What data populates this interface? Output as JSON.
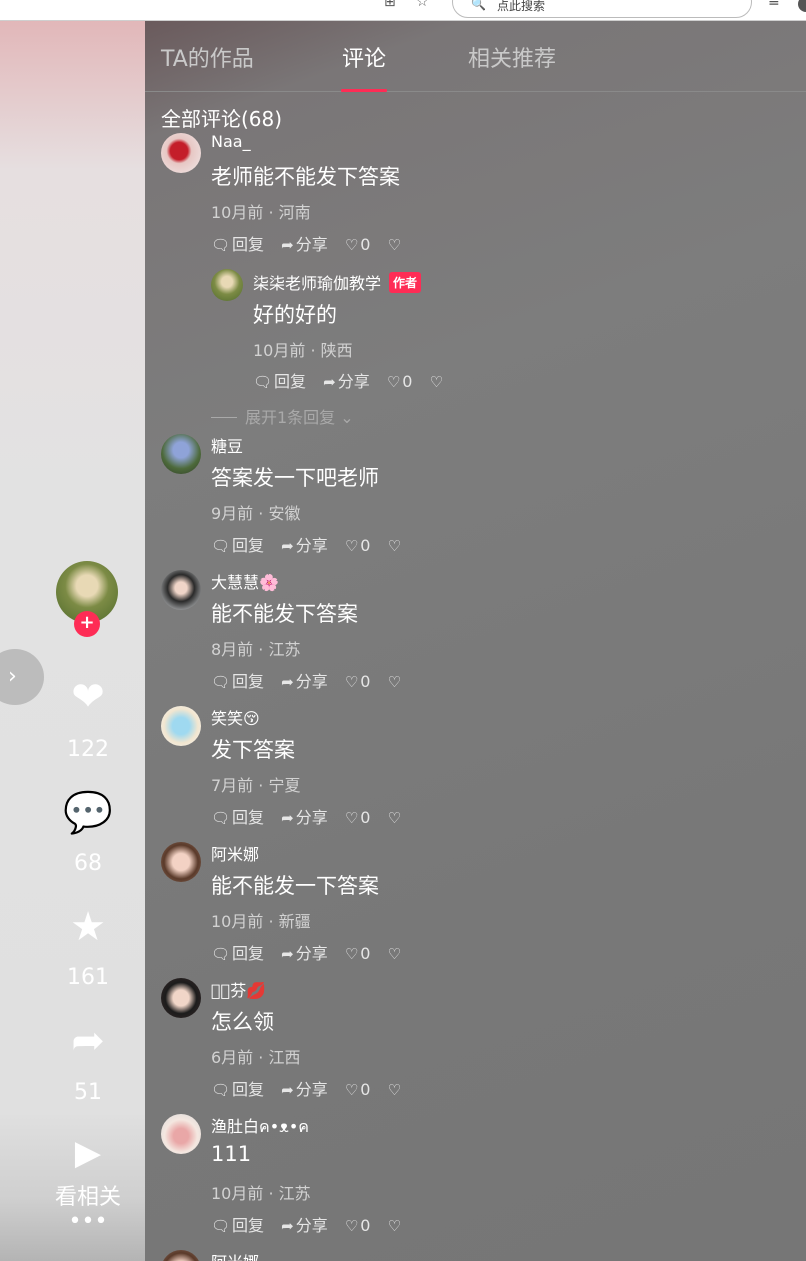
{
  "browser": {
    "search_placeholder": "点此搜索"
  },
  "sidebar": {
    "like_count": "122",
    "comment_count": "68",
    "favorite_count": "161",
    "share_count": "51",
    "related_label": "看相关",
    "more_label": "•••"
  },
  "tabs": [
    {
      "label": "TA的作品",
      "active": false
    },
    {
      "label": "评论",
      "active": true
    },
    {
      "label": "相关推荐",
      "active": false
    }
  ],
  "comments_header": "全部评论(68)",
  "actions": {
    "reply": "回复",
    "share": "分享"
  },
  "author_badge": "作者",
  "expand_label": "展开1条回复",
  "comments": [
    {
      "user": "Naa_",
      "text": "老师能不能发下答案",
      "meta": "10月前 · 河南",
      "likes": "0"
    },
    {
      "user": "糖豆",
      "text": "答案发一下吧老师",
      "meta": "9月前 · 安徽",
      "likes": "0"
    },
    {
      "user": "大慧慧🌸",
      "text": "能不能发下答案",
      "meta": "8月前 · 江苏",
      "likes": "0"
    },
    {
      "user": "笑笑😚",
      "text": "发下答案",
      "meta": "7月前 · 宁夏",
      "likes": "0"
    },
    {
      "user": "阿米娜",
      "text": "能不能发一下答案",
      "meta": "10月前 · 新疆",
      "likes": "0"
    },
    {
      "user": "𝓶ꦿ芬💋",
      "text": "怎么领",
      "meta": "6月前 · 江西",
      "likes": "0"
    },
    {
      "user": "渔肚白ค•ᴥ•ค",
      "text": "111",
      "meta": "10月前 · 江苏",
      "likes": "0"
    },
    {
      "user": "阿米娜",
      "text": "",
      "meta": "",
      "likes": ""
    }
  ],
  "reply": {
    "user": "柒柒老师瑜伽教学",
    "text": "好的好的",
    "meta": "10月前 · 陕西",
    "likes": "0"
  },
  "colors": {
    "accent": "#fe2c55",
    "panel": "#7b7b7b"
  }
}
